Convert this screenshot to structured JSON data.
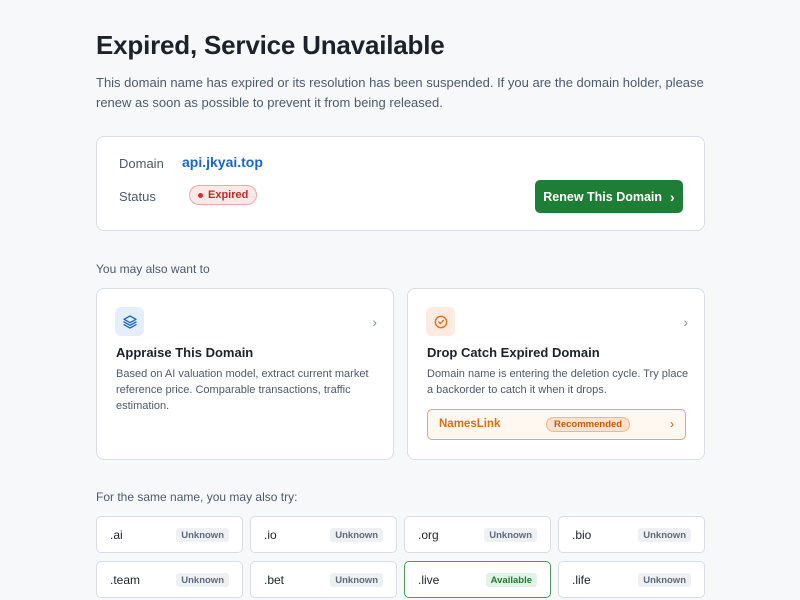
{
  "header": {
    "title": "Expired, Service Unavailable",
    "subtitle": "This domain name has expired or its resolution has been suspended. If you are the domain holder, please renew as soon as possible to prevent it from being released."
  },
  "domain_card": {
    "domain_label": "Domain",
    "domain_value": "api.jkyai.top",
    "status_label": "Status",
    "status_value": "Expired",
    "renew_label": "Renew This Domain",
    "renew_chevron": "›"
  },
  "suggestions": {
    "label": "You may also want to",
    "cards": [
      {
        "title": "Appraise This Domain",
        "description": "Based on AI valuation model, extract current market reference price. Comparable transactions, traffic estimation.",
        "icon": "layers-icon",
        "chevron": "›"
      },
      {
        "title": "Drop Catch Expired Domain",
        "description": "Domain name is entering the deletion cycle. Try place a backorder to catch it when it drops.",
        "icon": "check-circle-icon",
        "chevron": "›",
        "provider": {
          "name": "NamesLink",
          "badge": "Recommended",
          "chevron": "›"
        }
      }
    ]
  },
  "alternatives": {
    "label": "For the same name, you may also try:",
    "items": [
      {
        "tld": ".ai",
        "status": "Unknown"
      },
      {
        "tld": ".io",
        "status": "Unknown"
      },
      {
        "tld": ".org",
        "status": "Unknown"
      },
      {
        "tld": ".bio",
        "status": "Unknown"
      },
      {
        "tld": ".team",
        "status": "Unknown"
      },
      {
        "tld": ".bet",
        "status": "Unknown"
      },
      {
        "tld": ".live",
        "status": "Available"
      },
      {
        "tld": ".life",
        "status": "Unknown"
      }
    ]
  },
  "colors": {
    "accent_green": "#1f7e35",
    "link_blue": "#1a66cc",
    "expired_red": "#c62828",
    "recommend_orange": "#e06d14"
  }
}
